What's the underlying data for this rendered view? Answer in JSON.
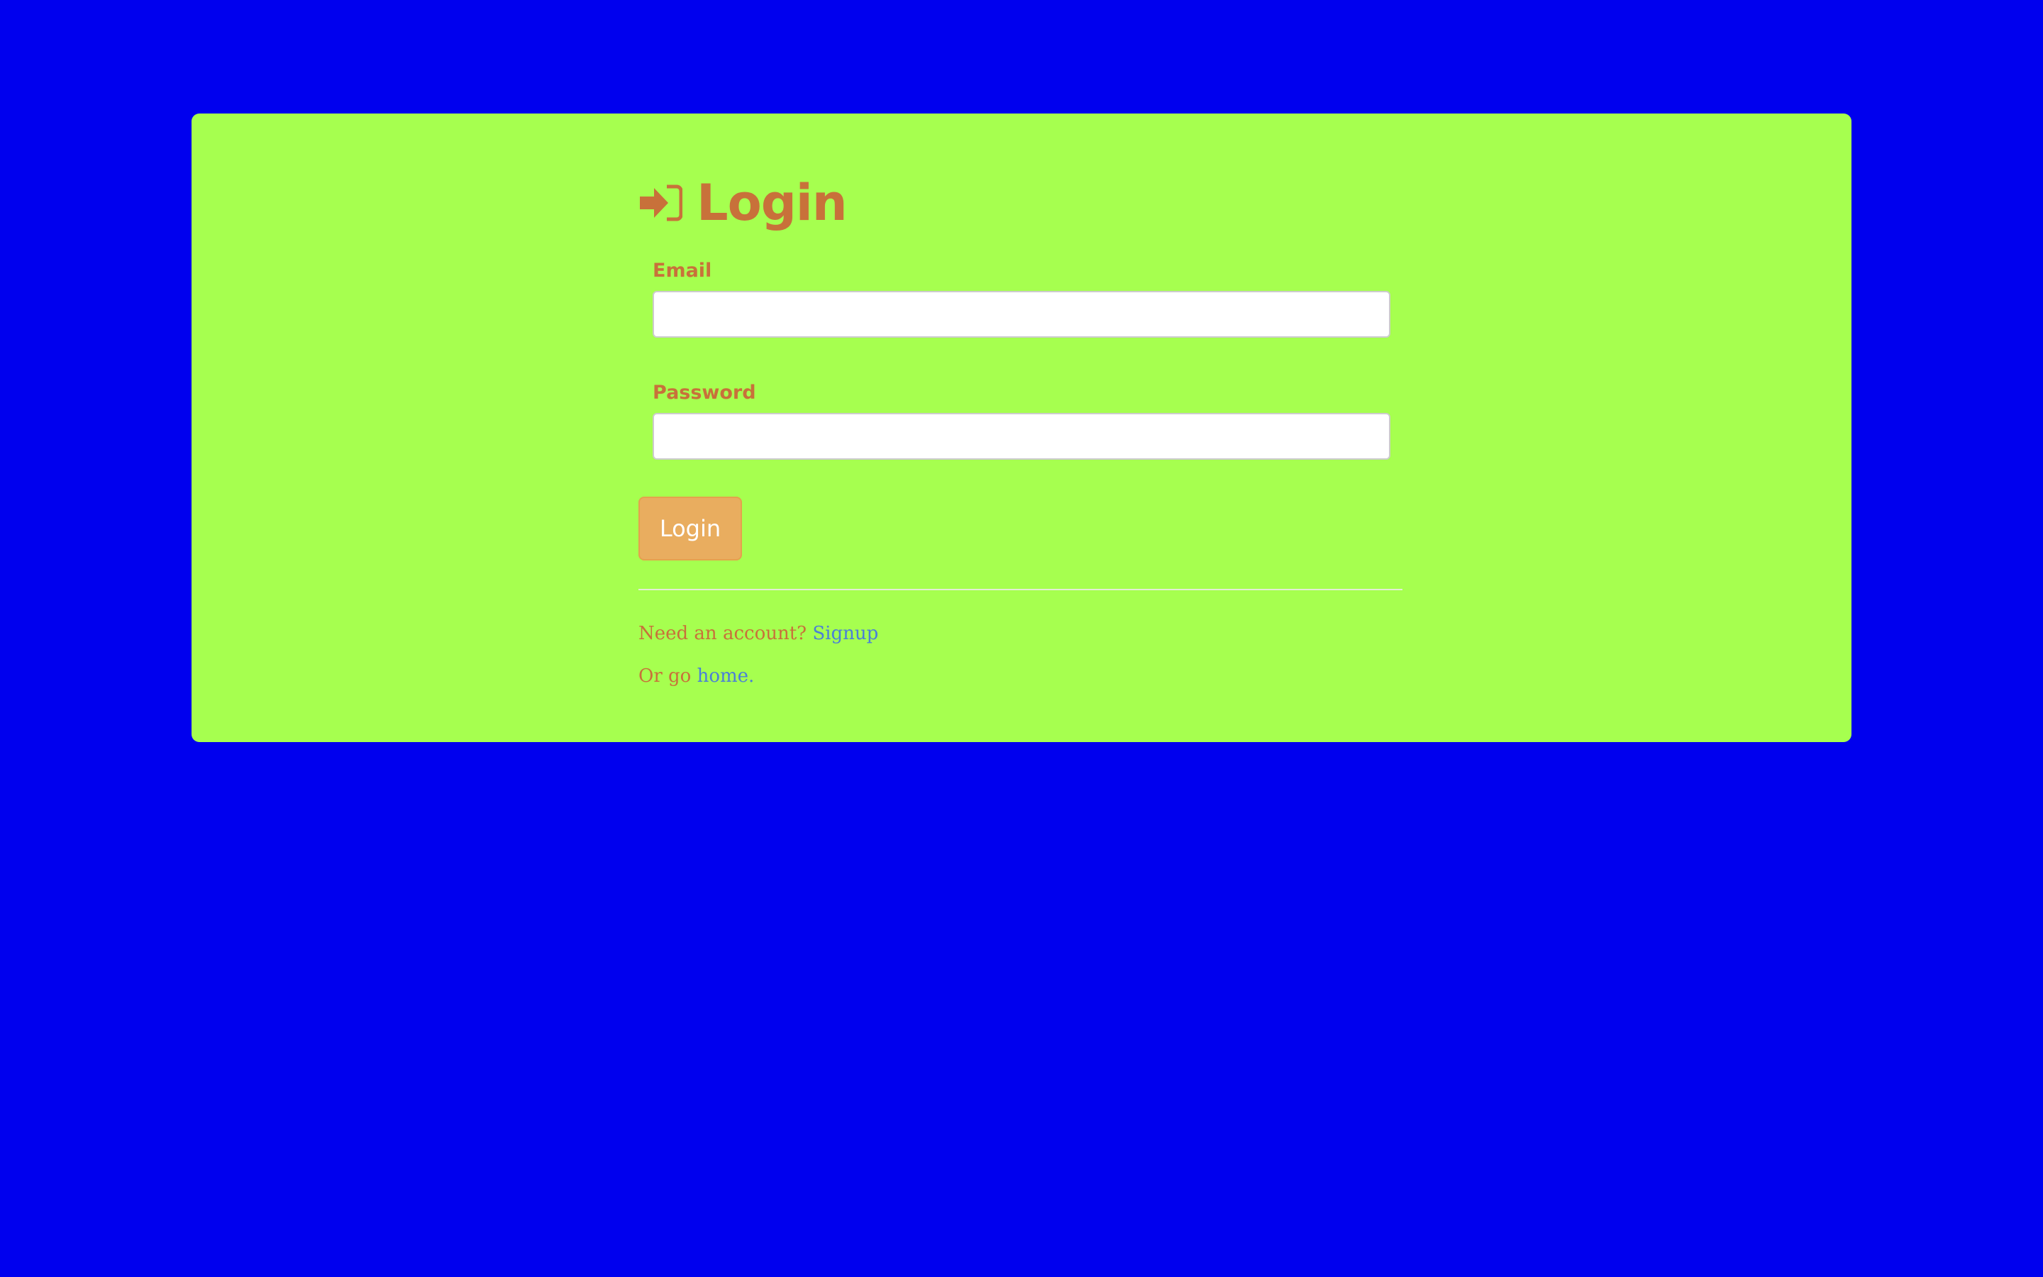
{
  "login": {
    "title": "Login",
    "icon": "sign-in-icon",
    "email_label": "Email",
    "email_value": "",
    "password_label": "Password",
    "password_value": "",
    "submit_label": "Login",
    "signup_prompt": "Need an account?",
    "signup_link": "Signup",
    "home_prompt": "Or go",
    "home_link": "home."
  },
  "colors": {
    "page_background": "#0000ee",
    "panel_background": "#a6ff4f",
    "text_accent": "#c8713a",
    "button_background": "#e9ad5f",
    "link": "#4a7fd8"
  }
}
